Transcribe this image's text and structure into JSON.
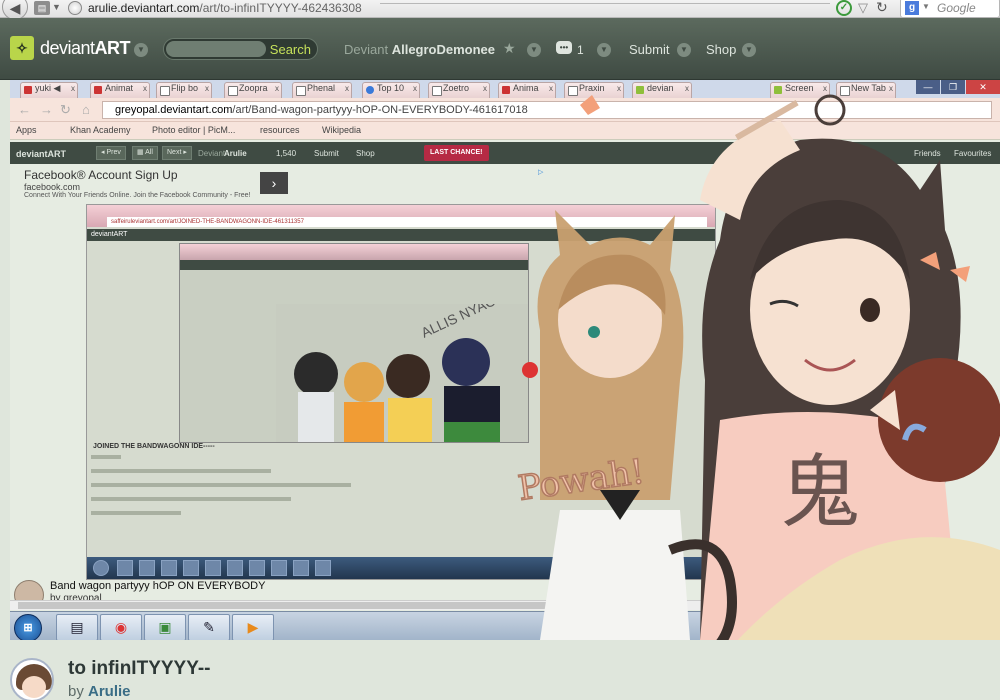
{
  "browser": {
    "url_host": "arulie.deviantart.com",
    "url_path": "/art/to-infinITYYYY-462436308",
    "search_engine": "Google"
  },
  "header": {
    "logo_text_light": "deviant",
    "logo_text_bold": "ART",
    "search_label": "Search",
    "deviant_prefix": "Deviant",
    "username": "AllegroDemonee",
    "message_count": "1",
    "submit": "Submit",
    "shop": "Shop"
  },
  "inner_screenshot": {
    "tabs": [
      "yuki",
      "Animat",
      "Flip bo",
      "Zoopra",
      "Phenal",
      "Top 10",
      "Zoetro",
      "Anima",
      "Praxin",
      "devian",
      "Screen",
      "New Tab"
    ],
    "url_host": "greyopal.deviantart.com",
    "url_path": "/art/Band-wagon-partyyy-hOP-ON-EVERYBODY-461617018",
    "bookmarks": [
      "Apps",
      "Khan Academy",
      "Photo editor | PicM...",
      "resources",
      "Wikipedia"
    ],
    "da_bar": {
      "logo": "deviantART",
      "prev": "◂ Prev",
      "all": "▦ All",
      "next": "Next ▸",
      "deviant": "Deviant",
      "user": "Arulie",
      "count": "1,540",
      "submit": "Submit",
      "shop": "Shop",
      "last_chance": "LAST CHANCE!",
      "friends": "Friends",
      "favourites": "Favourites"
    },
    "ad": {
      "title": "Facebook® Account Sign Up",
      "site": "facebook.com",
      "description": "Connect With Your Friends Online. Join the Facebook Community - Free!"
    },
    "nested_caption": "JOINED THE BANDWAGONN IDE-----",
    "nested_url": "saffeiruleviantart.com/art/JOINED-THE-BANDWAGONN-IDE-461311357",
    "deviation_title": "Band wagon partyyy hOP ON EVERYBODY",
    "deviation_by": "by greyopal",
    "taskbar_buttons": [
      "start",
      "explorer",
      "chrome",
      "app",
      "pen",
      "media"
    ]
  },
  "artwork": {
    "text_powah": "Powah!",
    "text_allis": "ALLIS NYAON",
    "kanji": "鬼"
  },
  "deviation": {
    "title": "to infinITYYYY--",
    "by_prefix": "by",
    "author": "Arulie"
  },
  "colors": {
    "header_bg": "#4a5a4e",
    "accent_green": "#b9d54a",
    "page_bg": "#dfe6dc",
    "author_link": "#3a6d86"
  }
}
